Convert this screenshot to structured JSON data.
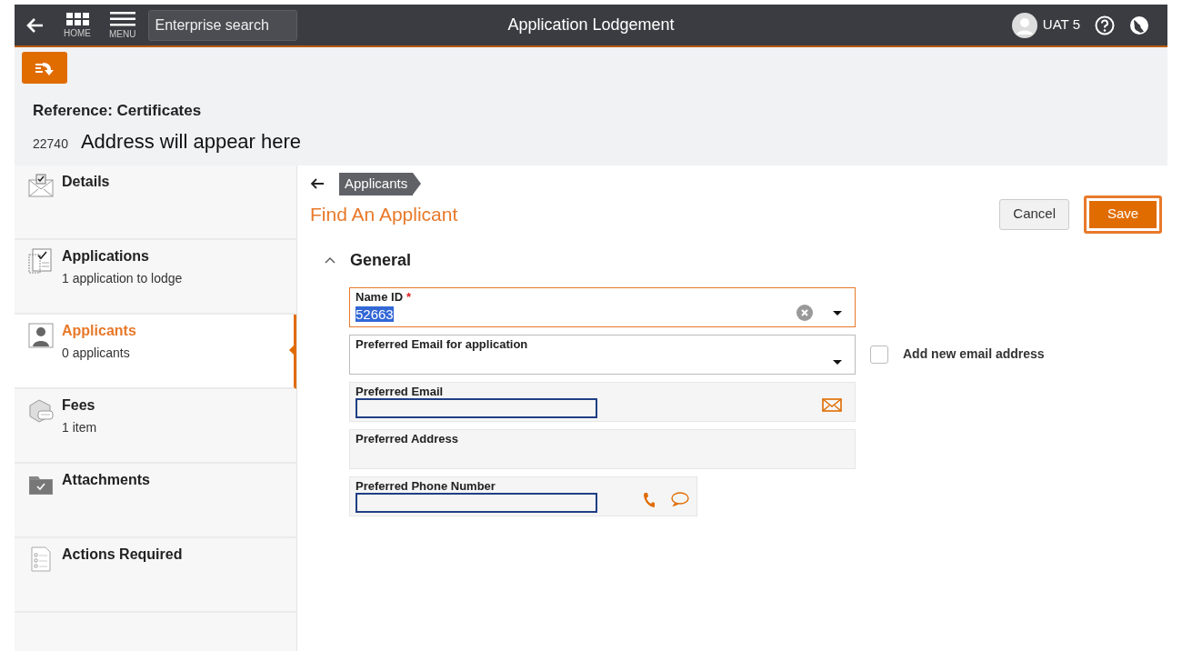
{
  "header": {
    "nav": [
      {
        "kind": "grid",
        "label": "HOME"
      },
      {
        "kind": "menu",
        "label": "MENU"
      }
    ],
    "search": {
      "placeholder": "Enterprise search"
    },
    "title": "Application Lodgement",
    "user": "UAT 5"
  },
  "reference": {
    "title": "Reference: Certificates",
    "number": "22740",
    "address": "Address will appear here"
  },
  "sidebar": {
    "items": [
      {
        "kind": "details",
        "label": "Details",
        "selected": false
      },
      {
        "kind": "applications",
        "label": "Applications",
        "sub": "1 application to lodge",
        "selected": false
      },
      {
        "kind": "applicants",
        "label": "Applicants",
        "sub": "0 applicants",
        "selected": true
      },
      {
        "kind": "fees",
        "label": "Fees",
        "sub": "1 item",
        "selected": false
      },
      {
        "kind": "attachments",
        "label": "Attachments",
        "selected": false
      },
      {
        "kind": "actions",
        "label": "Actions Required",
        "selected": false
      }
    ]
  },
  "breadcrumb": "Applicants",
  "page_title": "Find An Applicant",
  "buttons": [
    {
      "kind": "cancel",
      "label": "Cancel",
      "focused": false
    },
    {
      "kind": "save",
      "label": "Save",
      "focused": true
    }
  ],
  "section": {
    "title": "General",
    "expanded": true
  },
  "fields": [
    {
      "kind": "combo",
      "label": "Name ID",
      "required_marker": "*",
      "value": "52663",
      "value_selected": true,
      "focused": true
    },
    {
      "kind": "dropdown",
      "label": "Preferred Email for application",
      "focused": false,
      "checkbox": {
        "label": "Add new email address",
        "checked": false
      }
    },
    {
      "kind": "email",
      "label": "Preferred Email",
      "focused": false
    },
    {
      "kind": "address",
      "label": "Preferred Address",
      "focused": false
    },
    {
      "kind": "phone",
      "label": "Preferred Phone Number",
      "focused": false
    }
  ]
}
